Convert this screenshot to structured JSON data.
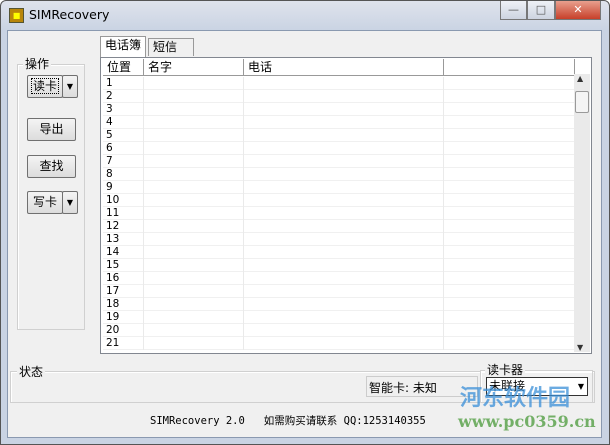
{
  "window": {
    "title": "SIMRecovery",
    "minimize": "—",
    "maximize": "□",
    "close": "✕"
  },
  "ops": {
    "group_label": "操作",
    "read_card": "读卡",
    "export": "导出",
    "find": "查找",
    "write_card": "写卡",
    "dropdown_glyph": "▼"
  },
  "tabs": [
    {
      "label": "电话簿",
      "active": true
    },
    {
      "label": "短信",
      "active": false
    }
  ],
  "table": {
    "columns": [
      "位置",
      "名字",
      "电话",
      ""
    ],
    "rows": [
      "1",
      "2",
      "3",
      "4",
      "5",
      "6",
      "7",
      "8",
      "9",
      "10",
      "11",
      "12",
      "13",
      "14",
      "15",
      "16",
      "17",
      "18",
      "19",
      "20",
      "21"
    ]
  },
  "status": {
    "group_label": "状态",
    "smart_card_label": "智能卡:",
    "smart_card_value": "未知"
  },
  "reader": {
    "group_label": "读卡器",
    "selected": "未联接"
  },
  "footer": {
    "version": "SIMRecovery 2.0",
    "contact": "如需购买请联系 QQ:1253140355"
  },
  "watermark": {
    "name": "河东软件园",
    "url": "www.pc0359.cn"
  }
}
